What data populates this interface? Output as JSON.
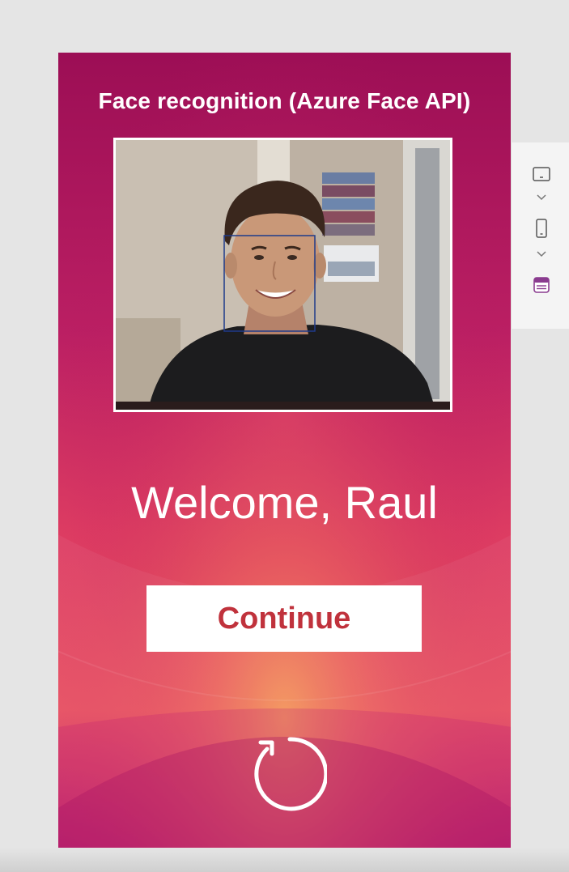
{
  "app": {
    "title": "Face recognition (Azure Face API)",
    "welcome": "Welcome, Raul",
    "continue_label": "Continue"
  },
  "icons": {
    "refresh": "refresh-icon",
    "tablet_view": "tablet-view-icon",
    "phone_view": "phone-view-icon",
    "web_view": "web-view-icon"
  },
  "colors": {
    "screen_base": "#b0155f",
    "accent_orange": "#f08a5c",
    "button_text": "#c0323c",
    "side_icon_active": "#8a3b8f"
  }
}
